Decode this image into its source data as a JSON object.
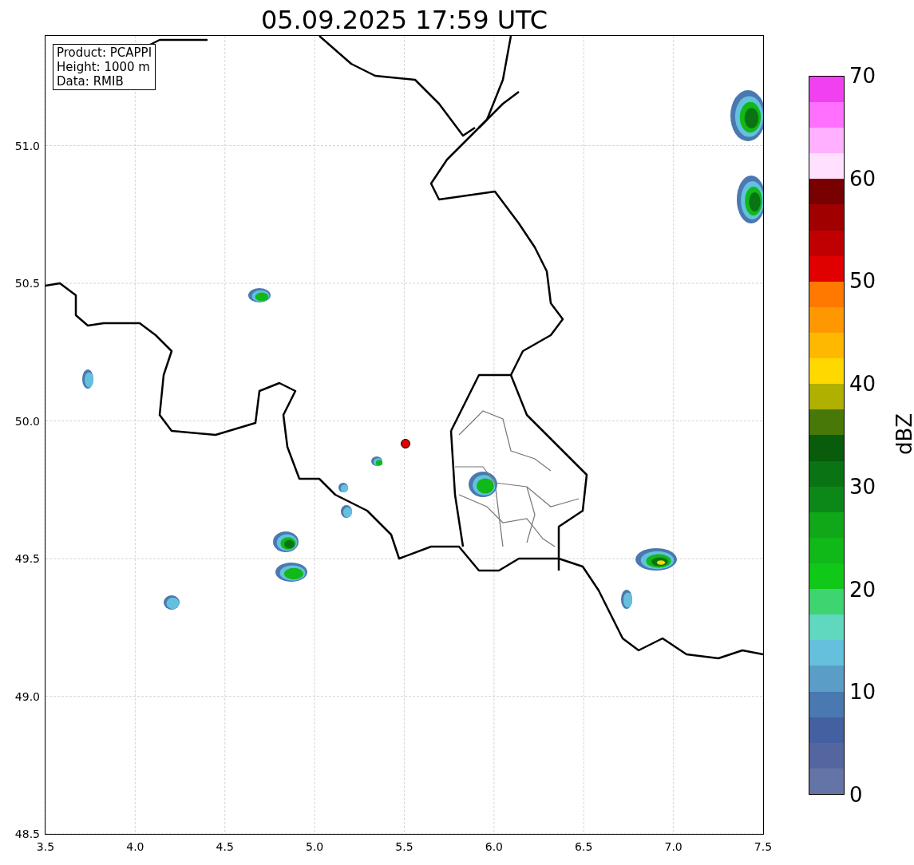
{
  "title": "05.09.2025 17:59 UTC",
  "info_box": [
    "Product: PCAPPI",
    "Height: 1000 m",
    "Data: RMIB"
  ],
  "map": {
    "xticks": [
      "3.5",
      "4.0",
      "4.5",
      "5.0",
      "5.5",
      "6.0",
      "6.5",
      "7.0",
      "7.5"
    ],
    "yticks": [
      "51.0",
      "50.5",
      "50.0",
      "49.5",
      "49.0",
      "48.5"
    ]
  },
  "colorbar": {
    "label": "dBZ",
    "ticks": [
      "70",
      "60",
      "50",
      "40",
      "30",
      "20",
      "10",
      "0"
    ],
    "segments": [
      {
        "color": "#6474a6"
      },
      {
        "color": "#5466a0"
      },
      {
        "color": "#4560a0"
      },
      {
        "color": "#4a78b0"
      },
      {
        "color": "#5a9ec8"
      },
      {
        "color": "#64c0dc"
      },
      {
        "color": "#60d8c0"
      },
      {
        "color": "#3ed470"
      },
      {
        "color": "#10c818"
      },
      {
        "color": "#10b818"
      },
      {
        "color": "#10a818"
      },
      {
        "color": "#0c8818"
      },
      {
        "color": "#0a7414"
      },
      {
        "color": "#085c0c"
      },
      {
        "color": "#487808"
      },
      {
        "color": "#b0b000"
      },
      {
        "color": "#ffd800"
      },
      {
        "color": "#ffb800"
      },
      {
        "color": "#ff9800"
      },
      {
        "color": "#ff7800"
      },
      {
        "color": "#e00000"
      },
      {
        "color": "#c00000"
      },
      {
        "color": "#a00000"
      },
      {
        "color": "#780000"
      },
      {
        "color": "#ffe0ff"
      },
      {
        "color": "#ffb0ff"
      },
      {
        "color": "#ff70ff"
      },
      {
        "color": "#f040f0"
      }
    ]
  }
}
